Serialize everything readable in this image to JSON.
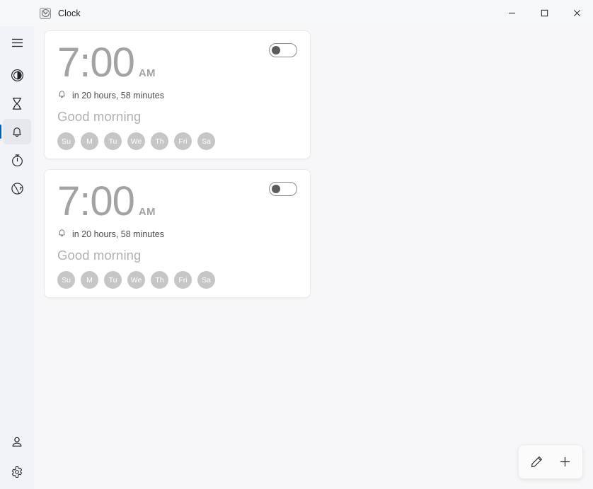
{
  "window": {
    "app_title": "Clock",
    "app_icon": "clock-icon",
    "controls": {
      "minimize_label": "Minimize",
      "maximize_label": "Maximize",
      "close_label": "Close"
    }
  },
  "sidebar": {
    "menu": {
      "icon": "hamburger-menu-icon",
      "label": "Navigation"
    },
    "items": [
      {
        "icon": "focus-sessions-icon",
        "label": "Focus sessions",
        "selected": false
      },
      {
        "icon": "hourglass-icon",
        "label": "Timer",
        "selected": false
      },
      {
        "icon": "bell-icon",
        "label": "Alarm",
        "selected": true
      },
      {
        "icon": "stopwatch-icon",
        "label": "Stopwatch",
        "selected": false
      },
      {
        "icon": "globe-icon",
        "label": "World clock",
        "selected": false
      }
    ],
    "bottom_items": [
      {
        "icon": "person-icon",
        "label": "Account"
      },
      {
        "icon": "gear-icon",
        "label": "Settings"
      }
    ]
  },
  "main": {
    "alarms": [
      {
        "time": "7:00",
        "meridiem": "AM",
        "countdown": "in 20 hours, 58 minutes",
        "countdown_icon": "bell-icon",
        "name": "Good morning",
        "enabled": false,
        "days": [
          "Su",
          "M",
          "Tu",
          "We",
          "Th",
          "Fri",
          "Sa"
        ]
      },
      {
        "time": "7:00",
        "meridiem": "AM",
        "countdown": "in 20 hours, 58 minutes",
        "countdown_icon": "bell-icon",
        "name": "Good morning",
        "enabled": false,
        "days": [
          "Su",
          "M",
          "Tu",
          "We",
          "Th",
          "Fri",
          "Sa"
        ]
      }
    ],
    "actions": [
      {
        "icon": "pencil-icon",
        "label": "Edit alarms"
      },
      {
        "icon": "plus-icon",
        "label": "Add an alarm"
      }
    ]
  },
  "colors": {
    "accent": "#005fb8",
    "window_bg": "#f7f7f9",
    "sidebar_bg": "#f1f3f7",
    "card_bg": "#ffffff",
    "muted_text": "#a3a3a3",
    "day_chip": "#c6c6c6"
  }
}
